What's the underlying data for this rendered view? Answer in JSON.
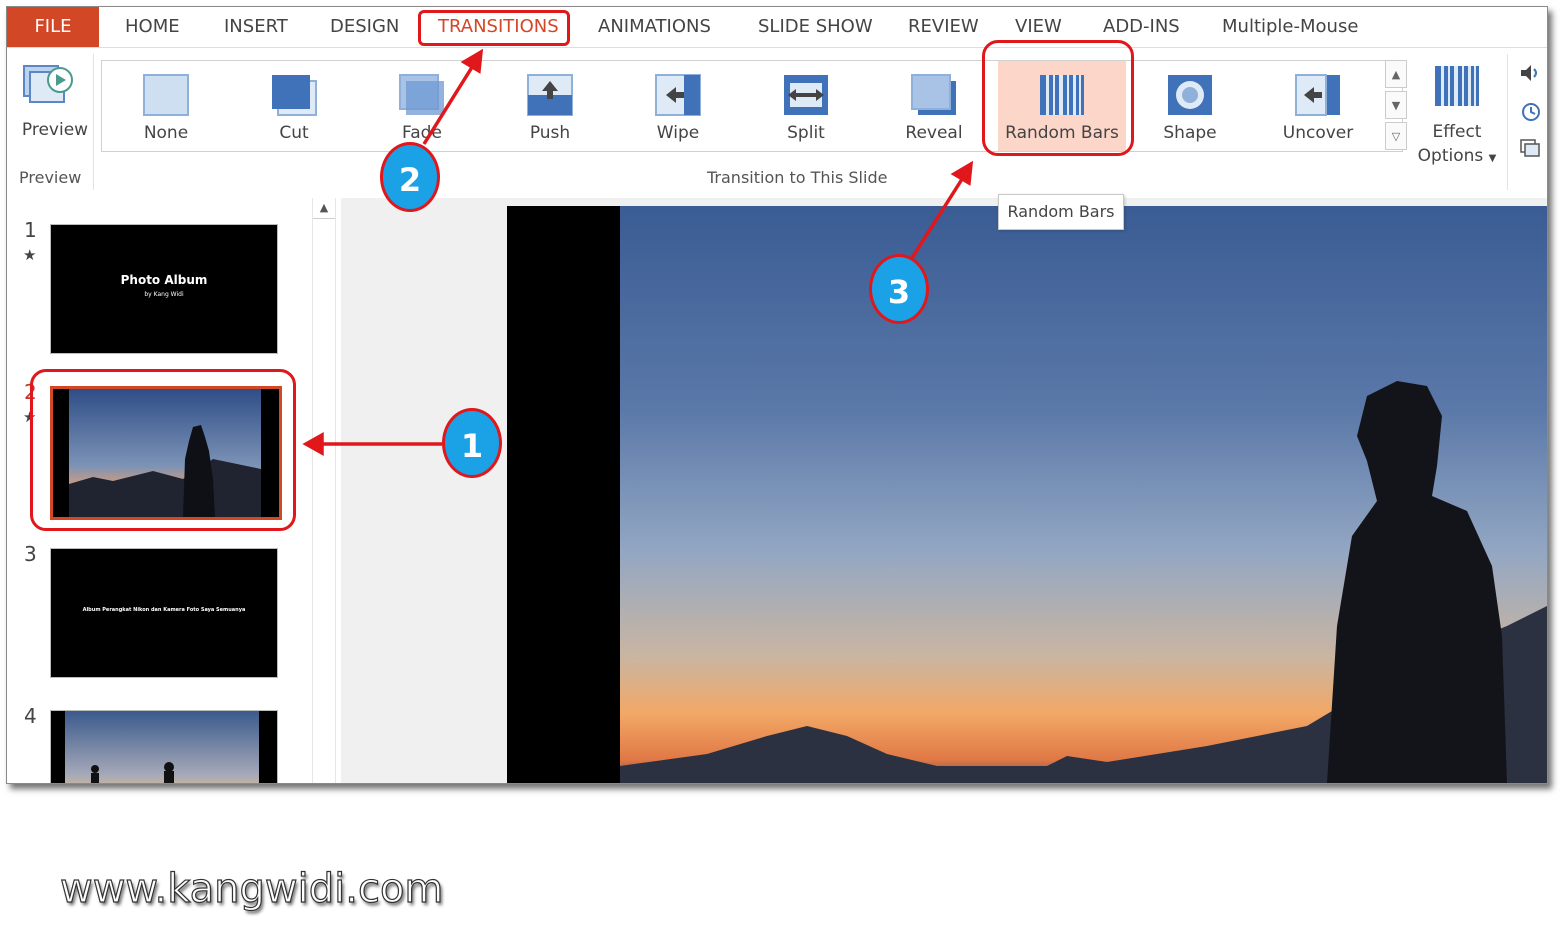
{
  "tabs": [
    "FILE",
    "HOME",
    "INSERT",
    "DESIGN",
    "TRANSITIONS",
    "ANIMATIONS",
    "SLIDE SHOW",
    "REVIEW",
    "VIEW",
    "ADD-INS",
    "Multiple-Mouse"
  ],
  "preview": {
    "label": "Preview",
    "group": "Preview"
  },
  "transitions": [
    "None",
    "Cut",
    "Fade",
    "Push",
    "Wipe",
    "Split",
    "Reveal",
    "Random Bars",
    "Shape",
    "Uncover"
  ],
  "selected_transition": "Random Bars",
  "effect_options": {
    "line1": "Effect",
    "line2": "Options"
  },
  "group_label": "Transition to This Slide",
  "tooltip": "Random Bars",
  "slides": [
    {
      "number": "1",
      "title": "Photo Album",
      "subtitle": "by Kang Widi",
      "starred": true
    },
    {
      "number": "2",
      "starred": true,
      "selected": true
    },
    {
      "number": "3",
      "text": "Album Perangkat Nikon dan Kamera Foto Saya Semuanya"
    },
    {
      "number": "4"
    }
  ],
  "badges": [
    "1",
    "2",
    "3"
  ],
  "watermark": "www.kangwidi.com",
  "colors": {
    "accent": "#d24726",
    "callout": "#e0171b",
    "badge": "#1aa1e6",
    "selected_fill": "#fcd6c9"
  }
}
